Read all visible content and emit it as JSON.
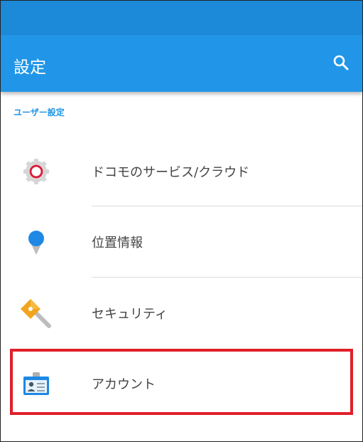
{
  "app_bar": {
    "title": "設定"
  },
  "section": {
    "header": "ユーザー設定"
  },
  "items": [
    {
      "label": "ドコモのサービス/クラウド",
      "icon": "docomo-gear-icon"
    },
    {
      "label": "位置情報",
      "icon": "location-pin-icon"
    },
    {
      "label": "セキュリティ",
      "icon": "key-icon"
    },
    {
      "label": "アカウント",
      "icon": "id-card-icon"
    }
  ],
  "colors": {
    "status_bar": "#1c8ad8",
    "app_bar": "#2196e8",
    "accent": "#2196e8",
    "highlight": "#e0202a"
  }
}
